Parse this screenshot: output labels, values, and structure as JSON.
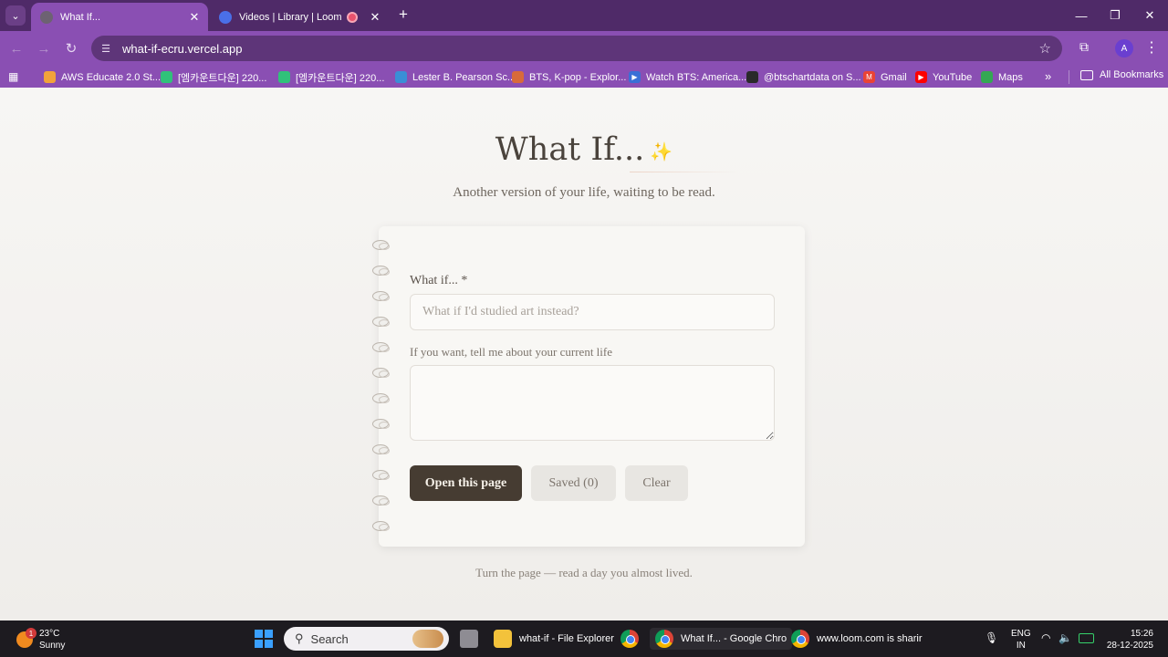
{
  "browser": {
    "tabs": [
      {
        "title": "What If...",
        "active": true
      },
      {
        "title": "Videos | Library | Loom",
        "active": false,
        "recording": true
      }
    ],
    "url": "what-if-ecru.vercel.app",
    "profile_initial": "A",
    "bookmarks": [
      {
        "label": "AWS Educate 2.0 St...",
        "icon": "aws-icon",
        "color": "#f2a33a"
      },
      {
        "label": "[엠카운트다운] 220...",
        "icon": "mnet-icon",
        "color": "#30c27a"
      },
      {
        "label": "[엠카운트다운] 220...",
        "icon": "mnet-icon",
        "color": "#30c27a"
      },
      {
        "label": "Lester B. Pearson Sc...",
        "icon": "school-icon",
        "color": "#3a8fd6"
      },
      {
        "label": "BTS, K-pop - Explor...",
        "icon": "rocket-icon",
        "color": "#d86a3a"
      },
      {
        "label": "Watch BTS: America...",
        "icon": "play-icon",
        "color": "#3a6fd6"
      },
      {
        "label": "@btschartdata on S...",
        "icon": "btschart-icon",
        "color": "#2a2a2a"
      },
      {
        "label": "Gmail",
        "icon": "gmail-icon",
        "color": "#ea4335"
      },
      {
        "label": "YouTube",
        "icon": "youtube-icon",
        "color": "#ff0000"
      },
      {
        "label": "Maps",
        "icon": "maps-icon",
        "color": "#34a853"
      }
    ],
    "all_bookmarks_label": "All Bookmarks"
  },
  "page": {
    "title": "What If...",
    "subtitle": "Another version of your life, waiting to be read.",
    "form": {
      "what_if_label": "What if... *",
      "what_if_value": "",
      "what_if_placeholder": "What if I'd studied art instead?",
      "current_life_label": "If you want, tell me about your current life",
      "current_life_value": ""
    },
    "buttons": {
      "open": "Open this page",
      "saved": "Saved (0)",
      "clear": "Clear"
    },
    "footer": "Turn the page — read a day you almost lived."
  },
  "taskbar": {
    "weather": {
      "temp": "23°C",
      "condition": "Sunny",
      "badge": "1"
    },
    "search_label": "Search",
    "apps": [
      {
        "label": "what-if - File Explorer",
        "icon": "folder-icon"
      },
      {
        "label": "What If... - Google Chro",
        "icon": "chrome-icon",
        "active": true
      },
      {
        "label": "www.loom.com is sharir",
        "icon": "chrome-icon"
      }
    ],
    "language": "ENG",
    "region": "IN",
    "time": "15:26",
    "date": "28-12-2025"
  }
}
